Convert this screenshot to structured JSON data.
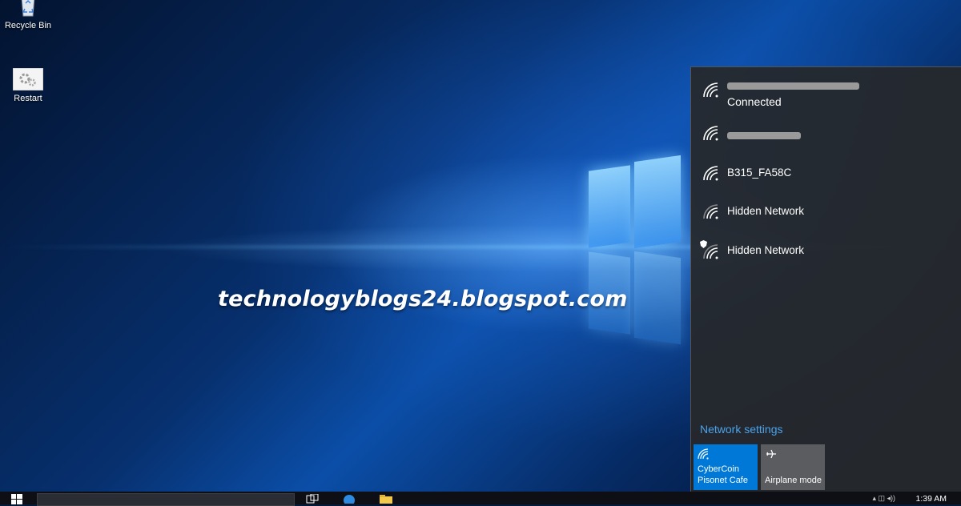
{
  "desktop": {
    "icons": [
      {
        "label": "Recycle Bin",
        "icon": "recycle-bin-icon"
      },
      {
        "label": "Restart",
        "icon": "restart-gear-icon"
      }
    ],
    "watermark": "technologyblogs24.blogspot.com"
  },
  "network_flyout": {
    "networks": [
      {
        "name": "",
        "status": "Connected",
        "redacted": true,
        "secured": false
      },
      {
        "name": "",
        "status": "",
        "redacted": true,
        "secured": false
      },
      {
        "name": "B315_FA58C",
        "status": "",
        "redacted": false,
        "secured": false
      },
      {
        "name": "Hidden Network",
        "status": "",
        "redacted": false,
        "secured": false
      },
      {
        "name": "Hidden Network",
        "status": "",
        "redacted": false,
        "secured": true
      }
    ],
    "settings_link": "Network settings",
    "tiles": [
      {
        "label_line1": "CyberCoin",
        "label_line2": "Pisonet Cafe",
        "icon": "wifi-icon",
        "active": true,
        "color": "#0078d7"
      },
      {
        "label_line1": "",
        "label_line2": "Airplane mode",
        "icon": "airplane-icon",
        "active": false,
        "color": "#5a5c60"
      }
    ]
  },
  "taskbar": {
    "clock_time": "1:39 AM",
    "icons": [
      "start-icon",
      "task-view-icon",
      "edge-icon",
      "file-explorer-icon"
    ]
  }
}
